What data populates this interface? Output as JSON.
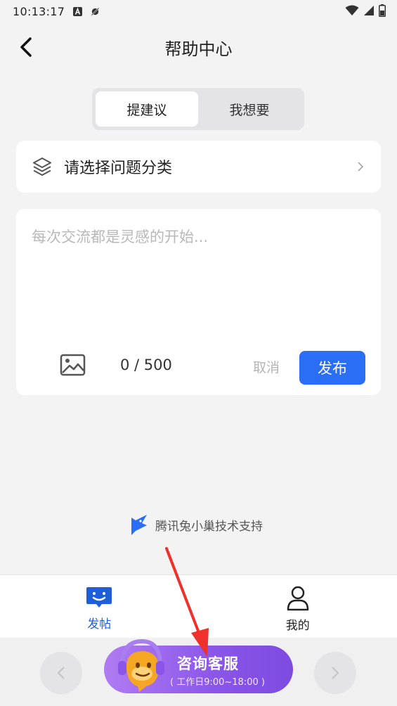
{
  "status_bar": {
    "time": "10:13:17",
    "icons": [
      "a-notification-icon",
      "no-location-icon",
      "wifi-icon",
      "signal-icon",
      "battery-icon"
    ]
  },
  "header": {
    "title": "帮助中心",
    "back_icon": "chevron-left-icon"
  },
  "segment": {
    "tabs": [
      {
        "label": "提建议",
        "active": true
      },
      {
        "label": "我想要",
        "active": false
      }
    ]
  },
  "category": {
    "label": "请选择问题分类",
    "icon": "layers-icon"
  },
  "editor": {
    "placeholder": "每次交流都是灵感的开始...",
    "value": "",
    "counter": "0 / 500",
    "cancel_label": "取消",
    "publish_label": "发布"
  },
  "footer_credit": {
    "text": "腾讯兔小巢技术支持"
  },
  "tabbar": {
    "items": [
      {
        "label": "发帖",
        "active": true,
        "icon": "message-smile-icon"
      },
      {
        "label": "我的",
        "active": false,
        "icon": "user-icon"
      }
    ]
  },
  "consult": {
    "title": "咨询客服",
    "subtitle": "( 工作日9:00~18:00 )"
  },
  "colors": {
    "accent": "#2b6ef6",
    "tab_active": "#1e5ed8",
    "consult_gradient_start": "#b07cf2",
    "consult_gradient_end": "#7d4be0",
    "annotation_arrow": "#f0302a"
  }
}
